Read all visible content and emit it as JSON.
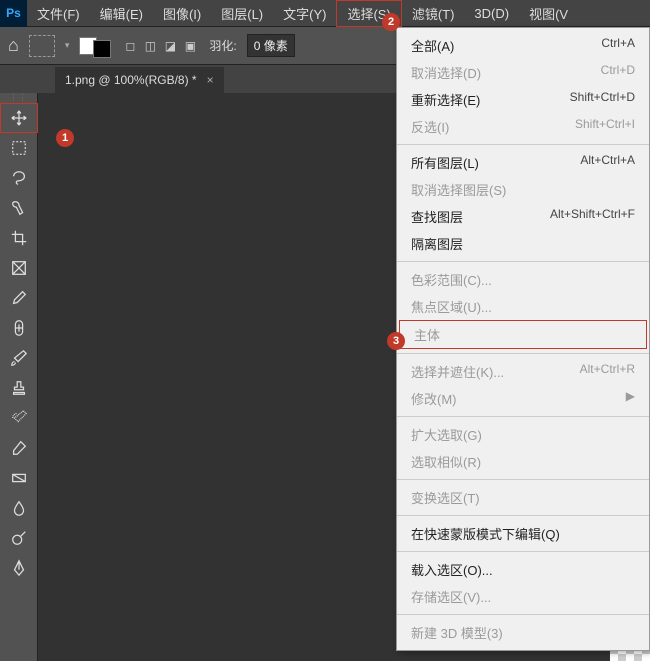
{
  "app": {
    "logo": "Ps"
  },
  "menu": {
    "items": [
      {
        "label": "文件(F)",
        "active": false
      },
      {
        "label": "编辑(E)",
        "active": false
      },
      {
        "label": "图像(I)",
        "active": false
      },
      {
        "label": "图层(L)",
        "active": false
      },
      {
        "label": "文字(Y)",
        "active": false
      },
      {
        "label": "选择(S)",
        "active": true
      },
      {
        "label": "滤镜(T)",
        "active": false
      },
      {
        "label": "3D(D)",
        "active": false
      },
      {
        "label": "视图(V",
        "active": false
      }
    ]
  },
  "options": {
    "feather_label": "羽化:",
    "feather_value": "0 像素"
  },
  "tab": {
    "title": "1.png @ 100%(RGB/8) *",
    "close": "×"
  },
  "tools": [
    {
      "name": "move",
      "active": true
    },
    {
      "name": "marquee",
      "active": false
    },
    {
      "name": "lasso",
      "active": false
    },
    {
      "name": "quick-select",
      "active": false
    },
    {
      "name": "crop",
      "active": false
    },
    {
      "name": "frame",
      "active": false
    },
    {
      "name": "eyedropper",
      "active": false
    },
    {
      "name": "healing",
      "active": false
    },
    {
      "name": "brush",
      "active": false
    },
    {
      "name": "stamp",
      "active": false
    },
    {
      "name": "history-brush",
      "active": false
    },
    {
      "name": "eraser",
      "active": false
    },
    {
      "name": "gradient",
      "active": false
    },
    {
      "name": "blur",
      "active": false
    },
    {
      "name": "dodge",
      "active": false
    },
    {
      "name": "pen",
      "active": false
    }
  ],
  "dropdown": [
    {
      "type": "item",
      "label": "全部(A)",
      "shortcut": "Ctrl+A",
      "disabled": false
    },
    {
      "type": "item",
      "label": "取消选择(D)",
      "shortcut": "Ctrl+D",
      "disabled": true
    },
    {
      "type": "item",
      "label": "重新选择(E)",
      "shortcut": "Shift+Ctrl+D",
      "disabled": false
    },
    {
      "type": "item",
      "label": "反选(I)",
      "shortcut": "Shift+Ctrl+I",
      "disabled": true
    },
    {
      "type": "sep"
    },
    {
      "type": "item",
      "label": "所有图层(L)",
      "shortcut": "Alt+Ctrl+A",
      "disabled": false
    },
    {
      "type": "item",
      "label": "取消选择图层(S)",
      "shortcut": "",
      "disabled": true
    },
    {
      "type": "item",
      "label": "查找图层",
      "shortcut": "Alt+Shift+Ctrl+F",
      "disabled": false
    },
    {
      "type": "item",
      "label": "隔离图层",
      "shortcut": "",
      "disabled": false
    },
    {
      "type": "sep"
    },
    {
      "type": "item",
      "label": "色彩范围(C)...",
      "shortcut": "",
      "disabled": true
    },
    {
      "type": "item",
      "label": "焦点区域(U)...",
      "shortcut": "",
      "disabled": true
    },
    {
      "type": "item",
      "label": "主体",
      "shortcut": "",
      "disabled": true,
      "hl": true
    },
    {
      "type": "sep"
    },
    {
      "type": "item",
      "label": "选择并遮住(K)...",
      "shortcut": "Alt+Ctrl+R",
      "disabled": true
    },
    {
      "type": "item",
      "label": "修改(M)",
      "shortcut": "",
      "disabled": true,
      "sub": true
    },
    {
      "type": "sep"
    },
    {
      "type": "item",
      "label": "扩大选取(G)",
      "shortcut": "",
      "disabled": true
    },
    {
      "type": "item",
      "label": "选取相似(R)",
      "shortcut": "",
      "disabled": true
    },
    {
      "type": "sep"
    },
    {
      "type": "item",
      "label": "变换选区(T)",
      "shortcut": "",
      "disabled": true
    },
    {
      "type": "sep"
    },
    {
      "type": "item",
      "label": "在快速蒙版模式下编辑(Q)",
      "shortcut": "",
      "disabled": false
    },
    {
      "type": "sep"
    },
    {
      "type": "item",
      "label": "载入选区(O)...",
      "shortcut": "",
      "disabled": false
    },
    {
      "type": "item",
      "label": "存储选区(V)...",
      "shortcut": "",
      "disabled": true
    },
    {
      "type": "sep"
    },
    {
      "type": "item",
      "label": "新建 3D 模型(3)",
      "shortcut": "",
      "disabled": true
    }
  ],
  "badges": {
    "b1": "1",
    "b2": "2",
    "b3": "3"
  }
}
